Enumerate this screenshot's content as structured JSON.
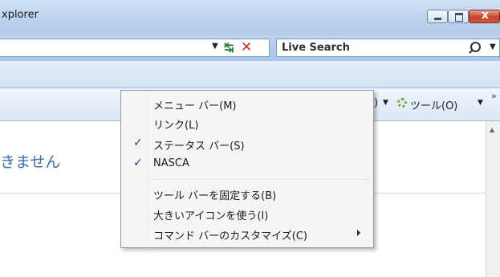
{
  "window": {
    "title": "xplorer"
  },
  "address": {
    "search_text": "Live Search"
  },
  "command_bar": {
    "page_fragment": ")",
    "tools_label": "ツール(O)"
  },
  "content": {
    "text": "きません"
  },
  "context_menu": {
    "items": [
      {
        "label": "メニュー バー(M)",
        "checked": false
      },
      {
        "label": "リンク(L)",
        "checked": false
      },
      {
        "label": "ステータス バー(S)",
        "checked": true,
        "check": "✓"
      },
      {
        "label": "NASCA",
        "checked": true,
        "check": "✓"
      },
      {
        "label": "ツール バーを固定する(B)",
        "checked": false
      },
      {
        "label": "大きいアイコンを使う(I)",
        "checked": false
      },
      {
        "label": "コマンド バーのカスタマイズ(C)",
        "checked": false,
        "submenu": true
      }
    ]
  },
  "icons": {
    "dropdown": "▼",
    "refresh": "↹",
    "stop": "✕",
    "close": "x",
    "more": "»",
    "scroll_up": "▲"
  }
}
